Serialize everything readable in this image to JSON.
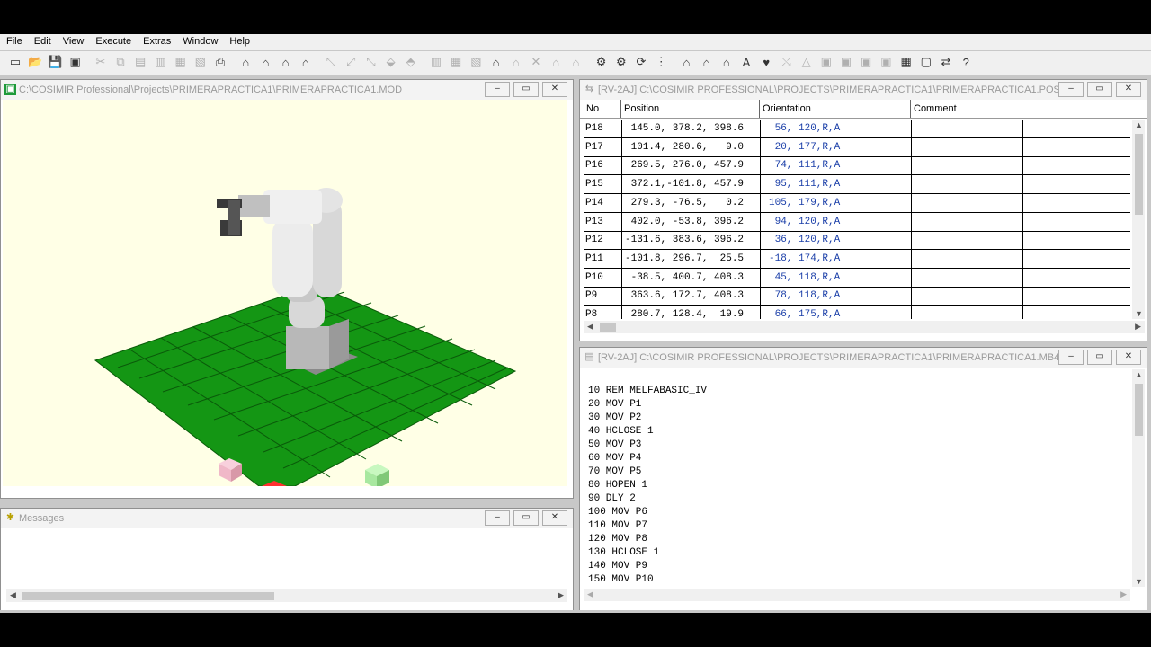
{
  "menu": [
    "File",
    "Edit",
    "View",
    "Execute",
    "Extras",
    "Window",
    "Help"
  ],
  "toolbar_icons": [
    "new-icon",
    "open-icon",
    "save-icon",
    "save-all-icon",
    "cut-icon",
    "copy-icon",
    "paste-icon",
    "paste-special-icon",
    "print-preview-icon",
    "print-setup-icon",
    "print-icon",
    "robot-icon-1",
    "robot-icon-2",
    "robot-icon-3",
    "robot-icon-4",
    "jog-icon-1",
    "jog-icon-2",
    "jog-icon-3",
    "jog-icon-4",
    "jog-icon-5",
    "tool-icon-1",
    "tool-icon-2",
    "tool-icon-3",
    "arm-icon-1",
    "arm-icon-2",
    "arm-icon-3",
    "arm-icon-4",
    "arm-icon-5",
    "search-icon",
    "teach-icon",
    "refresh-icon",
    "io-icon",
    "simulate-icon-1",
    "simulate-icon-2",
    "simulate-icon-3",
    "record-icon",
    "gripper-icon",
    "link-icon",
    "triangle-icon",
    "camera-icon-1",
    "camera-icon-2",
    "camera-icon-3",
    "camera-icon-4",
    "grid-icon",
    "window-icon",
    "connect-icon",
    "help-icon"
  ],
  "model_window": {
    "title": "C:\\COSIMIR Professional\\Projects\\PRIMERAPRACTICA1\\PRIMERAPRACTICA1.MOD"
  },
  "messages_window": {
    "title": "Messages"
  },
  "positions_window": {
    "title": "[RV-2AJ] C:\\COSIMIR PROFESSIONAL\\PROJECTS\\PRIMERAPRACTICA1\\PRIMERAPRACTICA1.POS",
    "columns": [
      "No",
      "Position",
      "Orientation",
      "Comment"
    ],
    "rows": [
      {
        "no": "P18",
        "pos": " 145.0, 378.2, 398.6",
        "ori": " 56, 120,R,A"
      },
      {
        "no": "P17",
        "pos": " 101.4, 280.6,   9.0",
        "ori": " 20, 177,R,A"
      },
      {
        "no": "P16",
        "pos": " 269.5, 276.0, 457.9",
        "ori": " 74, 111,R,A"
      },
      {
        "no": "P15",
        "pos": " 372.1,-101.8, 457.9",
        "ori": " 95, 111,R,A"
      },
      {
        "no": "P14",
        "pos": " 279.3, -76.5,   0.2",
        "ori": "105, 179,R,A"
      },
      {
        "no": "P13",
        "pos": " 402.0, -53.8, 396.2",
        "ori": " 94, 120,R,A"
      },
      {
        "no": "P12",
        "pos": "-131.6, 383.6, 396.2",
        "ori": " 36, 120,R,A"
      },
      {
        "no": "P11",
        "pos": "-101.8, 296.7,  25.5",
        "ori": "-18, 174,R,A"
      },
      {
        "no": "P10",
        "pos": " -38.5, 400.7, 408.3",
        "ori": " 45, 118,R,A"
      },
      {
        "no": "P9",
        "pos": " 363.6, 172.7, 408.3",
        "ori": " 78, 118,R,A"
      },
      {
        "no": "P8",
        "pos": " 280.7, 128.4,  19.9",
        "ori": " 66, 175,R,A"
      }
    ]
  },
  "program_window": {
    "title": "[RV-2AJ] C:\\COSIMIR PROFESSIONAL\\PROJECTS\\PRIMERAPRACTICA1\\PRIMERAPRACTICA1.MB4",
    "lines": [
      "10 REM MELFABASIC_IV",
      "20 MOV P1",
      "30 MOV P2",
      "40 HCLOSE 1",
      "50 MOV P3",
      "60 MOV P4",
      "70 MOV P5",
      "80 HOPEN 1",
      "90 DLY 2",
      "100 MOV P6",
      "110 MOV P7",
      "120 MOV P8",
      "130 HCLOSE 1",
      "140 MOV P9",
      "150 MOV P10"
    ]
  },
  "colors": {
    "floor": "#149614",
    "grid_line": "#0a5a0a",
    "cube_red": "#e00000",
    "cube_pink": "#f0b8c8",
    "cube_green": "#a8e8a0",
    "scene_bg": "#ffffe6",
    "orientation_text": "#1a3ea8"
  }
}
